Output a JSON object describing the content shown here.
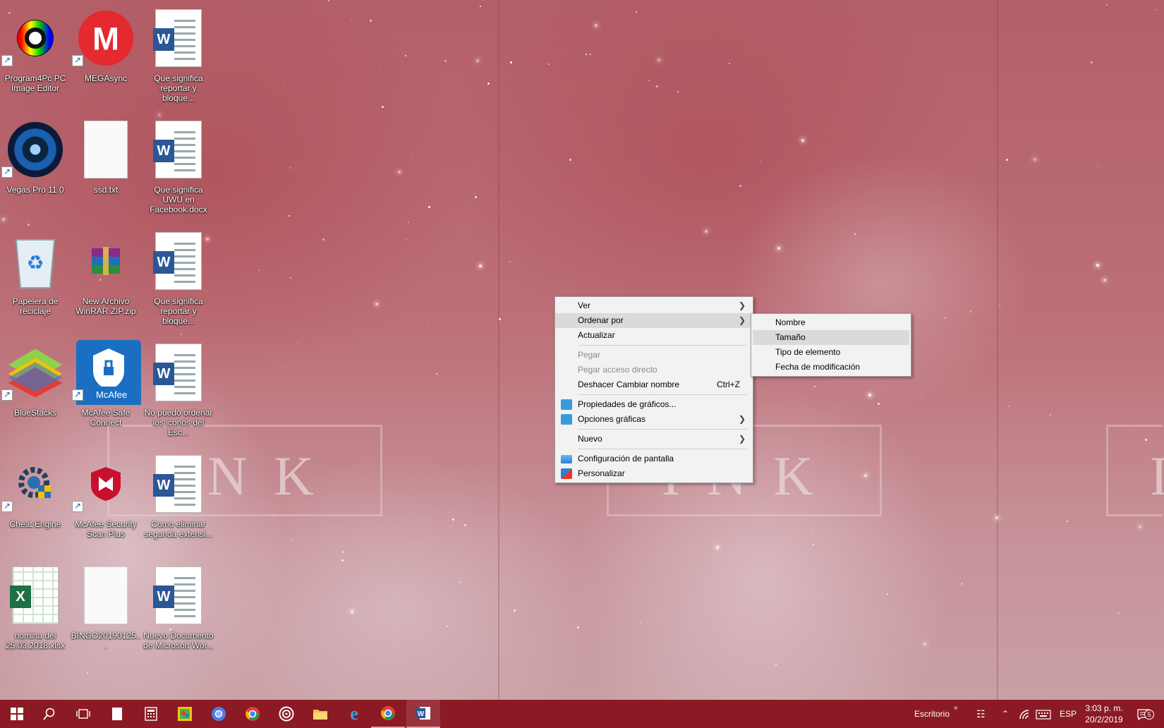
{
  "desktop": {
    "icons": [
      {
        "label": "Program4Pc PC Image Editor",
        "icon": "image-editor-icon"
      },
      {
        "label": "MEGAsync",
        "icon": "mega-icon"
      },
      {
        "label": "Que significa reportar y bloque...",
        "icon": "word-doc-icon"
      },
      {
        "label": "Vegas Pro 11.0",
        "icon": "vegas-icon"
      },
      {
        "label": "ssd.txt",
        "icon": "text-file-icon"
      },
      {
        "label": "Que significa UWU en Facebook.docx",
        "icon": "word-doc-icon"
      },
      {
        "label": "Papelera de reciclaje",
        "icon": "recycle-bin-icon"
      },
      {
        "label": "New Archivo WinRAR ZIP.zip",
        "icon": "winrar-icon"
      },
      {
        "label": "Que significa reportar y bloque...",
        "icon": "word-doc-icon"
      },
      {
        "label": "BlueStacks",
        "icon": "bluestacks-icon"
      },
      {
        "label": "McAfee Safe Connect",
        "icon": "mcafee-safe-connect-icon",
        "brand": "McAfee"
      },
      {
        "label": "No puedo ordenar los iconos del Esc...",
        "icon": "word-doc-icon"
      },
      {
        "label": "Cheat Engine",
        "icon": "cheat-engine-icon"
      },
      {
        "label": "McAfee Security Scan Plus",
        "icon": "mcafee-icon"
      },
      {
        "label": "Como eliminar segunda extensi...",
        "icon": "word-doc-icon"
      },
      {
        "label": "nomina del 25.03.2018.xlsx",
        "icon": "excel-doc-icon"
      },
      {
        "label": "BINGO20190125...",
        "icon": "blank-file-icon"
      },
      {
        "label": "Nuevo Documento de Microsoft Wor...",
        "icon": "word-doc-icon"
      }
    ],
    "wallpaper_text": "INK",
    "wallpaper_text_2": "INK",
    "wallpaper_text_3": "I"
  },
  "context_menu": {
    "items": [
      {
        "label": "Ver",
        "submenu": true
      },
      {
        "label": "Ordenar por",
        "submenu": true,
        "highlighted": true
      },
      {
        "label": "Actualizar"
      },
      {
        "separator": true
      },
      {
        "label": "Pegar",
        "disabled": true
      },
      {
        "label": "Pegar acceso directo",
        "disabled": true
      },
      {
        "label": "Deshacer Cambiar nombre",
        "shortcut": "Ctrl+Z"
      },
      {
        "separator": true
      },
      {
        "label": "Propiedades de gráficos...",
        "icon": "graphics-icon"
      },
      {
        "label": "Opciones gráficas",
        "icon": "graphics-icon",
        "submenu": true
      },
      {
        "separator": true
      },
      {
        "label": "Nuevo",
        "submenu": true
      },
      {
        "separator": true
      },
      {
        "label": "Configuración de pantalla",
        "icon": "display-icon"
      },
      {
        "label": "Personalizar",
        "icon": "personalize-icon"
      }
    ]
  },
  "submenu": {
    "items": [
      {
        "label": "Nombre"
      },
      {
        "label": "Tamaño",
        "highlighted": true
      },
      {
        "label": "Tipo de elemento"
      },
      {
        "label": "Fecha de modificación"
      }
    ]
  },
  "taskbar": {
    "tray_toolbar_label": "Escritorio",
    "language": "ESP",
    "time": "3:03 p. m.",
    "date": "20/2/2019",
    "notification_count": "5",
    "colors": {
      "taskbar": "#8b1a24",
      "menu_bg": "#f2f2f2",
      "menu_hover": "#dadada"
    }
  }
}
